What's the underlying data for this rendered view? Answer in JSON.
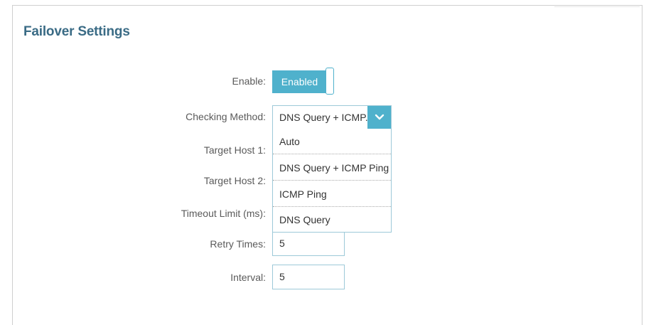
{
  "page": {
    "title": "Failover Settings"
  },
  "form": {
    "enable": {
      "label": "Enable:",
      "value": "Enabled"
    },
    "checking_method": {
      "label": "Checking Method:",
      "selected": "DNS Query + ICMP...",
      "options": [
        "Auto",
        "DNS Query + ICMP Ping",
        "ICMP Ping",
        "DNS Query"
      ]
    },
    "target_host_1": {
      "label": "Target Host 1:"
    },
    "target_host_2": {
      "label": "Target Host 2:"
    },
    "timeout_limit": {
      "label": "Timeout Limit (ms):"
    },
    "retry_times": {
      "label": "Retry Times:",
      "value": "5"
    },
    "interval": {
      "label": "Interval:",
      "value": "5"
    }
  },
  "colors": {
    "accent": "#4fb1cc",
    "title": "#3a6b85"
  },
  "icons": {
    "select_arrow": "chevron-down-icon"
  }
}
